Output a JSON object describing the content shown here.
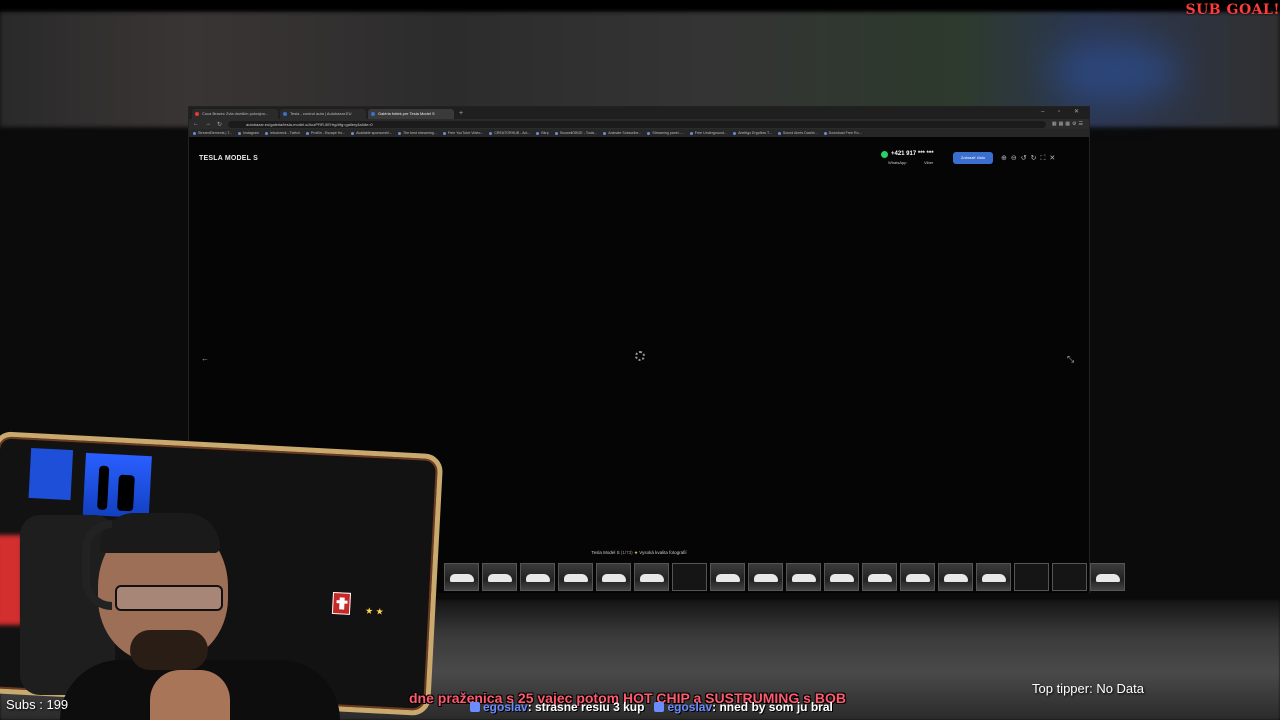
{
  "overlay": {
    "sub_goal": "SUB GOAL!",
    "subs": "Subs : 199",
    "top_tipper": "Top tipper: No Data",
    "ticker": "dne praženica s 25 vajec potom HOT CHIP a SUSTRUMING s BOB",
    "chat": [
      {
        "user": "egoslav",
        "message": ": strasne resiu 3 kup"
      },
      {
        "user": "egoslav",
        "message": ": nned by som ju bral"
      }
    ]
  },
  "browser": {
    "tabs": [
      {
        "label": "Cuca Bravec Zvla dnešlim pokrajno...",
        "active": false,
        "color": "#e53935"
      },
      {
        "label": "Tesla - control auta | Autobazar.EU",
        "active": false,
        "color": "#3b6fd0"
      },
      {
        "label": "Galéria fotiek pre Tesla Model S",
        "active": true,
        "color": "#3b6fd0"
      }
    ],
    "new_tab": "+",
    "window_controls": "– ▫ ✕",
    "url": "autobazar.eu/galeria/tesla-model-s/AozPRR-5EHrg/#fg=gallery&slide=0",
    "bookmarks": [
      "StreamElements | T...",
      "Instagram",
      "letsdoreck - Twitch",
      "Prolilin - Escape fro...",
      "Available sponsorshi...",
      "The best streaming...",
      "Free YouTube Video...",
      "CREATORHUB - Act...",
      "Bkrp",
      "SnowellOBGE - Tools...",
      "Animate Subscribe...",
      "Streaming panel -...",
      "Free Underground...",
      "Abeltigo Ergofiow T...",
      "Sound Alerts Dashb...",
      "Download Free Ro..."
    ]
  },
  "gallery": {
    "title": "TESLA MODEL S",
    "phone": "+421 917 *** ***",
    "whatsapp": "WhatsApp",
    "viber": "Viber",
    "show_button": "Zobraziť číslo",
    "tools": [
      "⊕",
      "⊖",
      "↺",
      "↻",
      "⛶",
      "✕"
    ],
    "prev": "←",
    "next": "⤡",
    "caption_title": "Tesla Model S",
    "caption_count": "(1/73)",
    "caption_quality": "Vysoká kvalita fotografií",
    "thumbs": [
      "car",
      "car",
      "car",
      "car",
      "car",
      "car",
      "dark",
      "car",
      "car",
      "car",
      "car",
      "car",
      "car",
      "car",
      "car",
      "dark",
      "dark",
      "car"
    ]
  }
}
